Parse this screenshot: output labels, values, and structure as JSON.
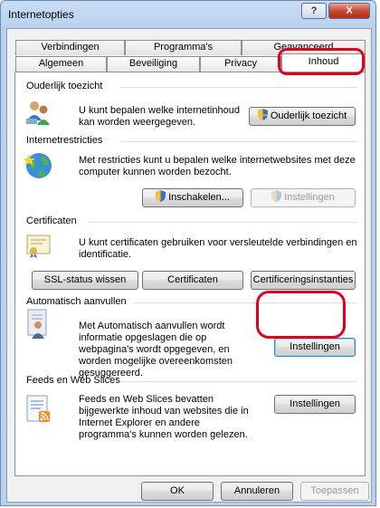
{
  "window": {
    "title": "Internetopties",
    "help_glyph": "?",
    "close_glyph": "X"
  },
  "tabs": {
    "row1": [
      "Verbindingen",
      "Programma's",
      "Geavanceerd"
    ],
    "row2": [
      "Algemeen",
      "Beveiliging",
      "Privacy",
      "Inhoud"
    ],
    "active": "Inhoud"
  },
  "sections": {
    "parental": {
      "title": "Ouderlijk toezicht",
      "text": "U kunt bepalen welke internetinhoud kan worden weergegeven.",
      "button": "Ouderlijk toezicht",
      "icon": "parental-users-icon"
    },
    "restrictions": {
      "title": "Internetrestricties",
      "text": "Met restricties kunt u bepalen welke internetwebsites met deze computer kunnen worden bezocht.",
      "enable_button": "Inschakelen...",
      "settings_button": "Instellingen",
      "icon": "globe-star-icon"
    },
    "certificates": {
      "title": "Certificaten",
      "text": "U kunt certificaten gebruiken voor versleutelde verbindingen en identificatie.",
      "ssl_button": "SSL-status wissen",
      "certs_button": "Certificaten",
      "authorities_button": "Certificeringsinstanties",
      "icon": "certificate-icon"
    },
    "autocomplete": {
      "title": "Automatisch aanvullen",
      "text": "Met Automatisch aanvullen wordt informatie opgeslagen die op webpagina's wordt opgegeven, en worden mogelijke overeenkomsten gesuggereerd.",
      "button": "Instellingen",
      "icon": "autocomplete-person-icon"
    },
    "feeds": {
      "title": "Feeds en Web Slices",
      "text": "Feeds en Web Slices bevatten bijgewerkte inhoud van websites die in Internet Explorer en andere programma's kunnen worden gelezen.",
      "button": "Instellingen",
      "icon": "feed-document-icon"
    }
  },
  "footer": {
    "ok": "OK",
    "cancel": "Annuleren",
    "apply": "Toepassen"
  },
  "colors": {
    "highlight": "#e1001a",
    "title_bar": "#b9d1ee"
  }
}
